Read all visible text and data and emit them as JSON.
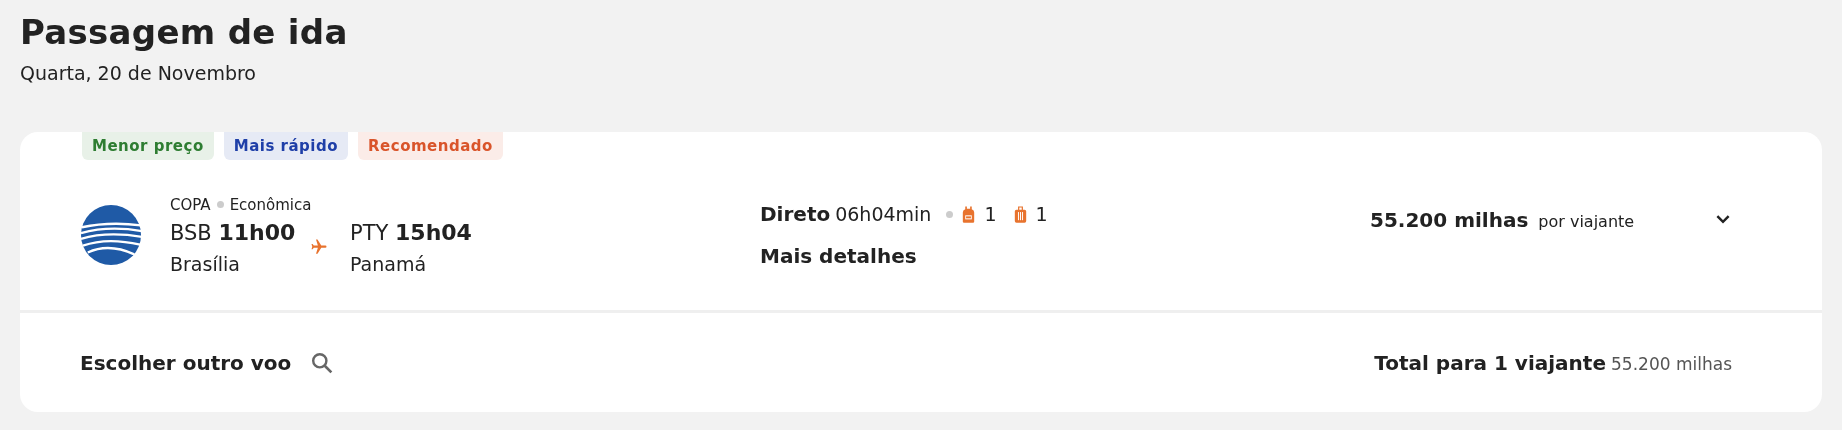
{
  "header": {
    "title": "Passagem de ida",
    "date": "Quarta, 20 de Novembro"
  },
  "flight": {
    "tags": [
      {
        "label": "Menor preço",
        "color": "#2e7d32"
      },
      {
        "label": "Mais rápido",
        "color": "#1f3fa8"
      },
      {
        "label": "Recomendado",
        "color": "#d9542a"
      }
    ],
    "airline": "COPA",
    "cabin": "Econômica",
    "origin": {
      "code": "BSB",
      "time": "11h00",
      "city": "Brasília"
    },
    "destination": {
      "code": "PTY",
      "time": "15h04",
      "city": "Panamá"
    },
    "stops": "Direto",
    "duration": "06h04min",
    "backpack_count": "1",
    "bag_count": "1",
    "details_link": "Mais detalhes",
    "price": "55.200 milhas",
    "price_note": "por viajante",
    "expanded": false
  },
  "footer": {
    "choose_other": "Escolher outro voo",
    "total_label": "Total para 1 viajante",
    "total_value": "55.200 milhas"
  }
}
